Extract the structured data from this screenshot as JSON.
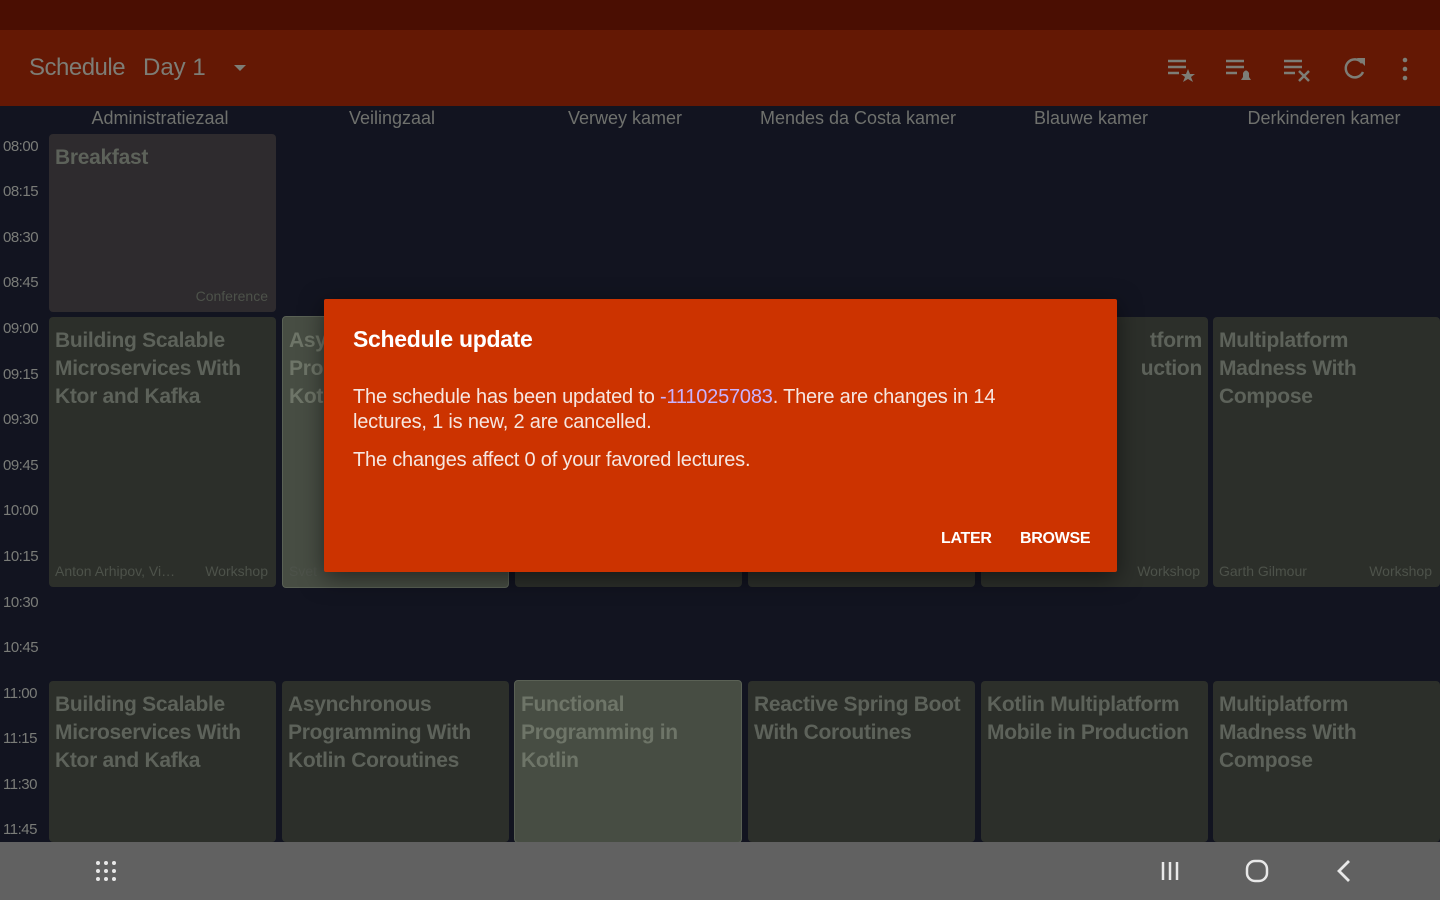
{
  "toolbar": {
    "title": "Schedule",
    "day": "Day 1",
    "icons": [
      "starred-list-icon",
      "alarm-list-icon",
      "clear-list-icon",
      "refresh-icon",
      "more-vert-icon"
    ]
  },
  "rooms": [
    "Administratiezaal",
    "Veilingzaal",
    "Verwey kamer",
    "Mendes da Costa kamer",
    "Blauwe kamer",
    "Derkinderen kamer"
  ],
  "times": [
    "08:00",
    "08:15",
    "08:30",
    "08:45",
    "09:00",
    "09:15",
    "09:30",
    "09:45",
    "10:00",
    "10:15",
    "10:30",
    "10:45",
    "11:00",
    "11:15",
    "11:30",
    "11:45"
  ],
  "sessions": {
    "breakfast": {
      "title": "Breakfast",
      "track": "Conference"
    },
    "row1_col1": {
      "title": "Building Scalable Microservices With Ktor and Kafka",
      "speaker": "Anton Arhipov, Vi…",
      "track": "Workshop"
    },
    "row1_col2": {
      "title": "Asy\nPro\nKotl",
      "speaker": "Svet"
    },
    "row1_col5": {
      "title": "tform\nuction",
      "track": "Workshop"
    },
    "row1_col6": {
      "title": "Multiplatform Madness With Compose",
      "speaker": "Garth Gilmour",
      "track": "Workshop"
    },
    "row2_col1": {
      "title": "Building Scalable Microservices With Ktor and Kafka"
    },
    "row2_col2": {
      "title": "Asynchronous Programming With Kotlin Coroutines"
    },
    "row2_col3": {
      "title": "Functional Programming in Kotlin"
    },
    "row2_col4": {
      "title": "Reactive Spring Boot With Coroutines"
    },
    "row2_col5": {
      "title": "Kotlin Multiplatform Mobile in Production"
    },
    "row2_col6": {
      "title": "Multiplatform Madness With Compose"
    }
  },
  "dialog": {
    "title": "Schedule update",
    "msg_prefix": "The schedule has been updated to ",
    "version": "-1110257083",
    "msg_suffix": ". There are changes in 14 lectures, 1 is new, 2 are cancelled.",
    "msg2": "The changes affect 0 of your favored lectures.",
    "later": "LATER",
    "browse": "BROWSE"
  },
  "navbar": {
    "icons": [
      "apps-grid-icon",
      "recents-icon",
      "home-icon",
      "back-icon"
    ]
  },
  "colors": {
    "toolbar": "#641804",
    "dialog": "#cc3300",
    "link": "#c9b3ff"
  }
}
